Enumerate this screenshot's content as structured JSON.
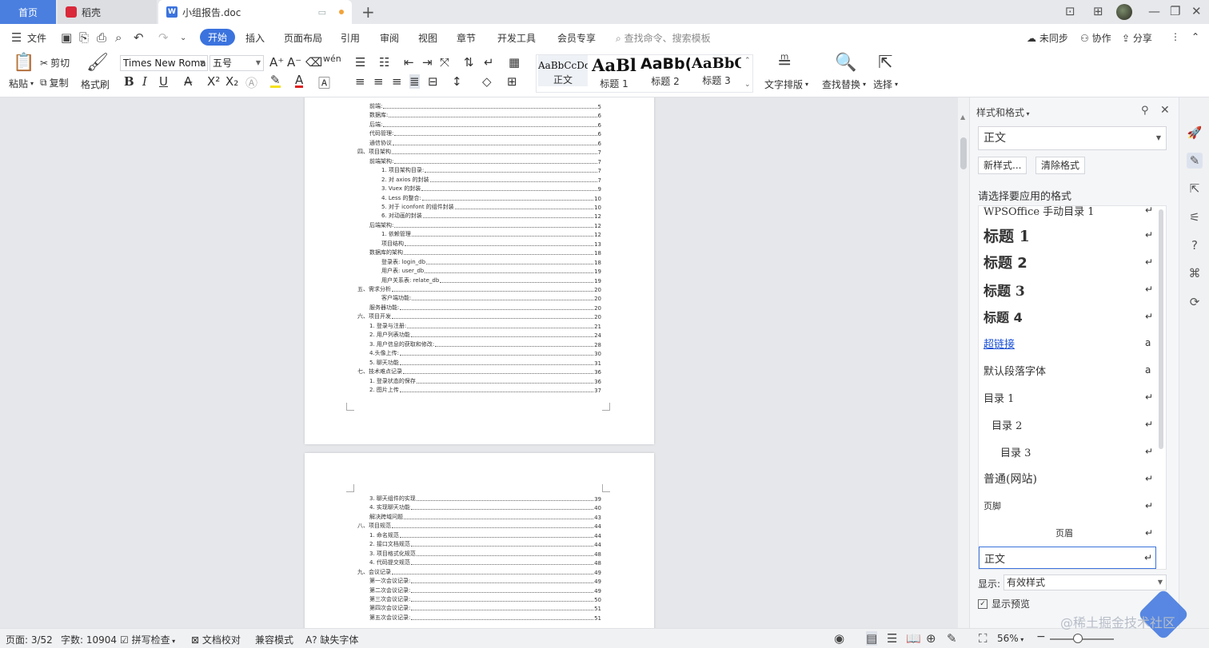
{
  "tabs": {
    "home": "首页",
    "daoke": "稻壳",
    "doc": "小组报告.doc",
    "new_tab": "+"
  },
  "window": {
    "layout_icon": "1⃞",
    "minimize": "—",
    "restore": "❐",
    "close": "✕"
  },
  "menu": {
    "file": "文件",
    "items": [
      "开始",
      "插入",
      "页面布局",
      "引用",
      "审阅",
      "视图",
      "章节",
      "开发工具",
      "会员专享"
    ],
    "search_placeholder": "查找命令、搜索模板",
    "unsynced": "未同步",
    "collab": "协作",
    "share": "分享"
  },
  "ribbon": {
    "paste": "粘贴",
    "cut": "剪切",
    "copy": "复制",
    "format_painter": "格式刷",
    "font_name": "Times New Roma",
    "font_size": "五号",
    "pinyin_glyph": "wén",
    "styles": [
      {
        "preview": "AaBbCcDd",
        "label": "正文"
      },
      {
        "preview": "AaBl",
        "label": "标题 1"
      },
      {
        "preview": "AaBb(",
        "label": "标题 2"
      },
      {
        "preview": "AaBbC",
        "label": "标题 3"
      }
    ],
    "text_layout": "文字排版",
    "find_replace": "查找替换",
    "select": "选择"
  },
  "page1_toc": [
    {
      "text": "前端:",
      "page": "5",
      "level": 1
    },
    {
      "text": "数据库:",
      "page": "6",
      "level": 1
    },
    {
      "text": "后端:",
      "page": "6",
      "level": 1
    },
    {
      "text": "代码管理:",
      "page": "6",
      "level": 1
    },
    {
      "text": "通信协议",
      "page": "6",
      "level": 1
    },
    {
      "text": "四、项目架构",
      "page": "7",
      "level": 0
    },
    {
      "text": "前端架构:",
      "page": "7",
      "level": 1
    },
    {
      "text": "1. 项目架构目录:",
      "page": "7",
      "level": 2
    },
    {
      "text": "2. 对 axios 的封装",
      "page": "7",
      "level": 2
    },
    {
      "text": "3. Vuex 的封装",
      "page": "9",
      "level": 2
    },
    {
      "text": "4. Less 的整合:",
      "page": "10",
      "level": 2
    },
    {
      "text": "5. 对于 iconfont 的组件封装",
      "page": "10",
      "level": 2
    },
    {
      "text": "6. 对动画的封装",
      "page": "12",
      "level": 2
    },
    {
      "text": "后端架构:",
      "page": "12",
      "level": 1
    },
    {
      "text": "1. 依赖管理",
      "page": "12",
      "level": 2
    },
    {
      "text": "项目结构",
      "page": "13",
      "level": 2
    },
    {
      "text": "数据库的架构",
      "page": "18",
      "level": 1
    },
    {
      "text": "登录表: login_db",
      "page": "18",
      "level": 2
    },
    {
      "text": "用户表: user_db",
      "page": "19",
      "level": 2
    },
    {
      "text": "用户关系表: relate_db",
      "page": "19",
      "level": 2
    },
    {
      "text": "五、需求分析",
      "page": "20",
      "level": 0
    },
    {
      "text": "客户端功能:",
      "page": "20",
      "level": 2
    },
    {
      "text": "服务器功能:",
      "page": "20",
      "level": 1
    },
    {
      "text": "六、项目开发",
      "page": "20",
      "level": 0
    },
    {
      "text": "1. 登录与注册:",
      "page": "21",
      "level": 1
    },
    {
      "text": "2. 用户列表功能",
      "page": "24",
      "level": 1
    },
    {
      "text": "3. 用户信息的获取和修改:",
      "page": "28",
      "level": 1
    },
    {
      "text": "4.头像上传:",
      "page": "30",
      "level": 1
    },
    {
      "text": "5. 聊天功能",
      "page": "31",
      "level": 1
    },
    {
      "text": "七、技术难点记录",
      "page": "36",
      "level": 0
    },
    {
      "text": "1. 登录状态的保存",
      "page": "36",
      "level": 1
    },
    {
      "text": "2. 图片上传",
      "page": "37",
      "level": 1
    }
  ],
  "page2_toc": [
    {
      "text": "3. 聊天组件的实现",
      "page": "39",
      "level": 1
    },
    {
      "text": "4. 实现聊天功能",
      "page": "40",
      "level": 1
    },
    {
      "text": "解决跨域问题",
      "page": "43",
      "level": 1
    },
    {
      "text": "八、项目规范",
      "page": "44",
      "level": 0
    },
    {
      "text": "1. 命名规范",
      "page": "44",
      "level": 1
    },
    {
      "text": "2. 接口文档规范",
      "page": "44",
      "level": 1
    },
    {
      "text": "3. 项目格式化规范",
      "page": "48",
      "level": 1
    },
    {
      "text": "4. 代码提交规范",
      "page": "48",
      "level": 1
    },
    {
      "text": "九、会议记录",
      "page": "49",
      "level": 0
    },
    {
      "text": "第一次会议记录:",
      "page": "49",
      "level": 1
    },
    {
      "text": "第二次会议记录:",
      "page": "49",
      "level": 1
    },
    {
      "text": "第三次会议记录:",
      "page": "50",
      "level": 1
    },
    {
      "text": "第四次会议记录:",
      "page": "51",
      "level": 1
    },
    {
      "text": "第五次会议记录:",
      "page": "51",
      "level": 1
    }
  ],
  "pane": {
    "title": "样式和格式",
    "current_style": "正文",
    "new_style": "新样式...",
    "clear_format": "清除格式",
    "choose_label": "请选择要应用的格式",
    "styles": [
      {
        "name": "WPSOffice 手动目录 1",
        "mark": "↵"
      },
      {
        "name": "标题  1",
        "mark": "↵"
      },
      {
        "name": "标题  2",
        "mark": "↵"
      },
      {
        "name": "标题  3",
        "mark": "↵"
      },
      {
        "name": "标题  4",
        "mark": "↵"
      },
      {
        "name": "超链接",
        "mark": "a"
      },
      {
        "name": "默认段落字体",
        "mark": "a"
      },
      {
        "name": "目录 1",
        "mark": "↵"
      },
      {
        "name": "目录 2",
        "mark": "↵"
      },
      {
        "name": "目录 3",
        "mark": "↵"
      },
      {
        "name": "普通(网站)",
        "mark": "↵"
      },
      {
        "name": "页脚",
        "mark": "↵"
      },
      {
        "name": "页眉",
        "mark": "↵"
      },
      {
        "name": "正文",
        "mark": "↵"
      }
    ],
    "show_label": "显示:",
    "show_value": "有效样式",
    "show_preview": "显示预览",
    "show_preview_checked": true
  },
  "status": {
    "page": "页面: 3/52",
    "words": "字数: 10904",
    "spellcheck": "拼写检查",
    "doc_check": "文档校对",
    "compat": "兼容模式",
    "missing_font": "缺失字体",
    "zoom": "56%",
    "zoom_level": 0.56
  },
  "watermark": "@稀土掘金技术社区"
}
